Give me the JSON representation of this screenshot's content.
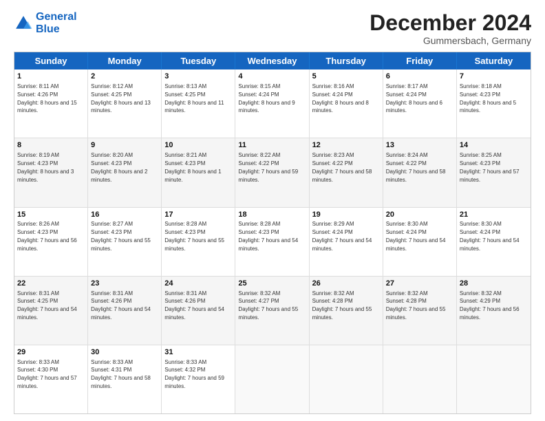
{
  "logo": {
    "line1": "General",
    "line2": "Blue"
  },
  "title": "December 2024",
  "subtitle": "Gummersbach, Germany",
  "days": [
    "Sunday",
    "Monday",
    "Tuesday",
    "Wednesday",
    "Thursday",
    "Friday",
    "Saturday"
  ],
  "rows": [
    [
      {
        "day": "1",
        "sunrise": "8:11 AM",
        "sunset": "4:26 PM",
        "daylight": "8 hours and 15 minutes."
      },
      {
        "day": "2",
        "sunrise": "8:12 AM",
        "sunset": "4:25 PM",
        "daylight": "8 hours and 13 minutes."
      },
      {
        "day": "3",
        "sunrise": "8:13 AM",
        "sunset": "4:25 PM",
        "daylight": "8 hours and 11 minutes."
      },
      {
        "day": "4",
        "sunrise": "8:15 AM",
        "sunset": "4:24 PM",
        "daylight": "8 hours and 9 minutes."
      },
      {
        "day": "5",
        "sunrise": "8:16 AM",
        "sunset": "4:24 PM",
        "daylight": "8 hours and 8 minutes."
      },
      {
        "day": "6",
        "sunrise": "8:17 AM",
        "sunset": "4:24 PM",
        "daylight": "8 hours and 6 minutes."
      },
      {
        "day": "7",
        "sunrise": "8:18 AM",
        "sunset": "4:23 PM",
        "daylight": "8 hours and 5 minutes."
      }
    ],
    [
      {
        "day": "8",
        "sunrise": "8:19 AM",
        "sunset": "4:23 PM",
        "daylight": "8 hours and 3 minutes."
      },
      {
        "day": "9",
        "sunrise": "8:20 AM",
        "sunset": "4:23 PM",
        "daylight": "8 hours and 2 minutes."
      },
      {
        "day": "10",
        "sunrise": "8:21 AM",
        "sunset": "4:23 PM",
        "daylight": "8 hours and 1 minute."
      },
      {
        "day": "11",
        "sunrise": "8:22 AM",
        "sunset": "4:22 PM",
        "daylight": "7 hours and 59 minutes."
      },
      {
        "day": "12",
        "sunrise": "8:23 AM",
        "sunset": "4:22 PM",
        "daylight": "7 hours and 58 minutes."
      },
      {
        "day": "13",
        "sunrise": "8:24 AM",
        "sunset": "4:22 PM",
        "daylight": "7 hours and 58 minutes."
      },
      {
        "day": "14",
        "sunrise": "8:25 AM",
        "sunset": "4:23 PM",
        "daylight": "7 hours and 57 minutes."
      }
    ],
    [
      {
        "day": "15",
        "sunrise": "8:26 AM",
        "sunset": "4:23 PM",
        "daylight": "7 hours and 56 minutes."
      },
      {
        "day": "16",
        "sunrise": "8:27 AM",
        "sunset": "4:23 PM",
        "daylight": "7 hours and 55 minutes."
      },
      {
        "day": "17",
        "sunrise": "8:28 AM",
        "sunset": "4:23 PM",
        "daylight": "7 hours and 55 minutes."
      },
      {
        "day": "18",
        "sunrise": "8:28 AM",
        "sunset": "4:23 PM",
        "daylight": "7 hours and 54 minutes."
      },
      {
        "day": "19",
        "sunrise": "8:29 AM",
        "sunset": "4:24 PM",
        "daylight": "7 hours and 54 minutes."
      },
      {
        "day": "20",
        "sunrise": "8:30 AM",
        "sunset": "4:24 PM",
        "daylight": "7 hours and 54 minutes."
      },
      {
        "day": "21",
        "sunrise": "8:30 AM",
        "sunset": "4:24 PM",
        "daylight": "7 hours and 54 minutes."
      }
    ],
    [
      {
        "day": "22",
        "sunrise": "8:31 AM",
        "sunset": "4:25 PM",
        "daylight": "7 hours and 54 minutes."
      },
      {
        "day": "23",
        "sunrise": "8:31 AM",
        "sunset": "4:26 PM",
        "daylight": "7 hours and 54 minutes."
      },
      {
        "day": "24",
        "sunrise": "8:31 AM",
        "sunset": "4:26 PM",
        "daylight": "7 hours and 54 minutes."
      },
      {
        "day": "25",
        "sunrise": "8:32 AM",
        "sunset": "4:27 PM",
        "daylight": "7 hours and 55 minutes."
      },
      {
        "day": "26",
        "sunrise": "8:32 AM",
        "sunset": "4:28 PM",
        "daylight": "7 hours and 55 minutes."
      },
      {
        "day": "27",
        "sunrise": "8:32 AM",
        "sunset": "4:28 PM",
        "daylight": "7 hours and 55 minutes."
      },
      {
        "day": "28",
        "sunrise": "8:32 AM",
        "sunset": "4:29 PM",
        "daylight": "7 hours and 56 minutes."
      }
    ],
    [
      {
        "day": "29",
        "sunrise": "8:33 AM",
        "sunset": "4:30 PM",
        "daylight": "7 hours and 57 minutes."
      },
      {
        "day": "30",
        "sunrise": "8:33 AM",
        "sunset": "4:31 PM",
        "daylight": "7 hours and 58 minutes."
      },
      {
        "day": "31",
        "sunrise": "8:33 AM",
        "sunset": "4:32 PM",
        "daylight": "7 hours and 59 minutes."
      },
      null,
      null,
      null,
      null
    ]
  ]
}
